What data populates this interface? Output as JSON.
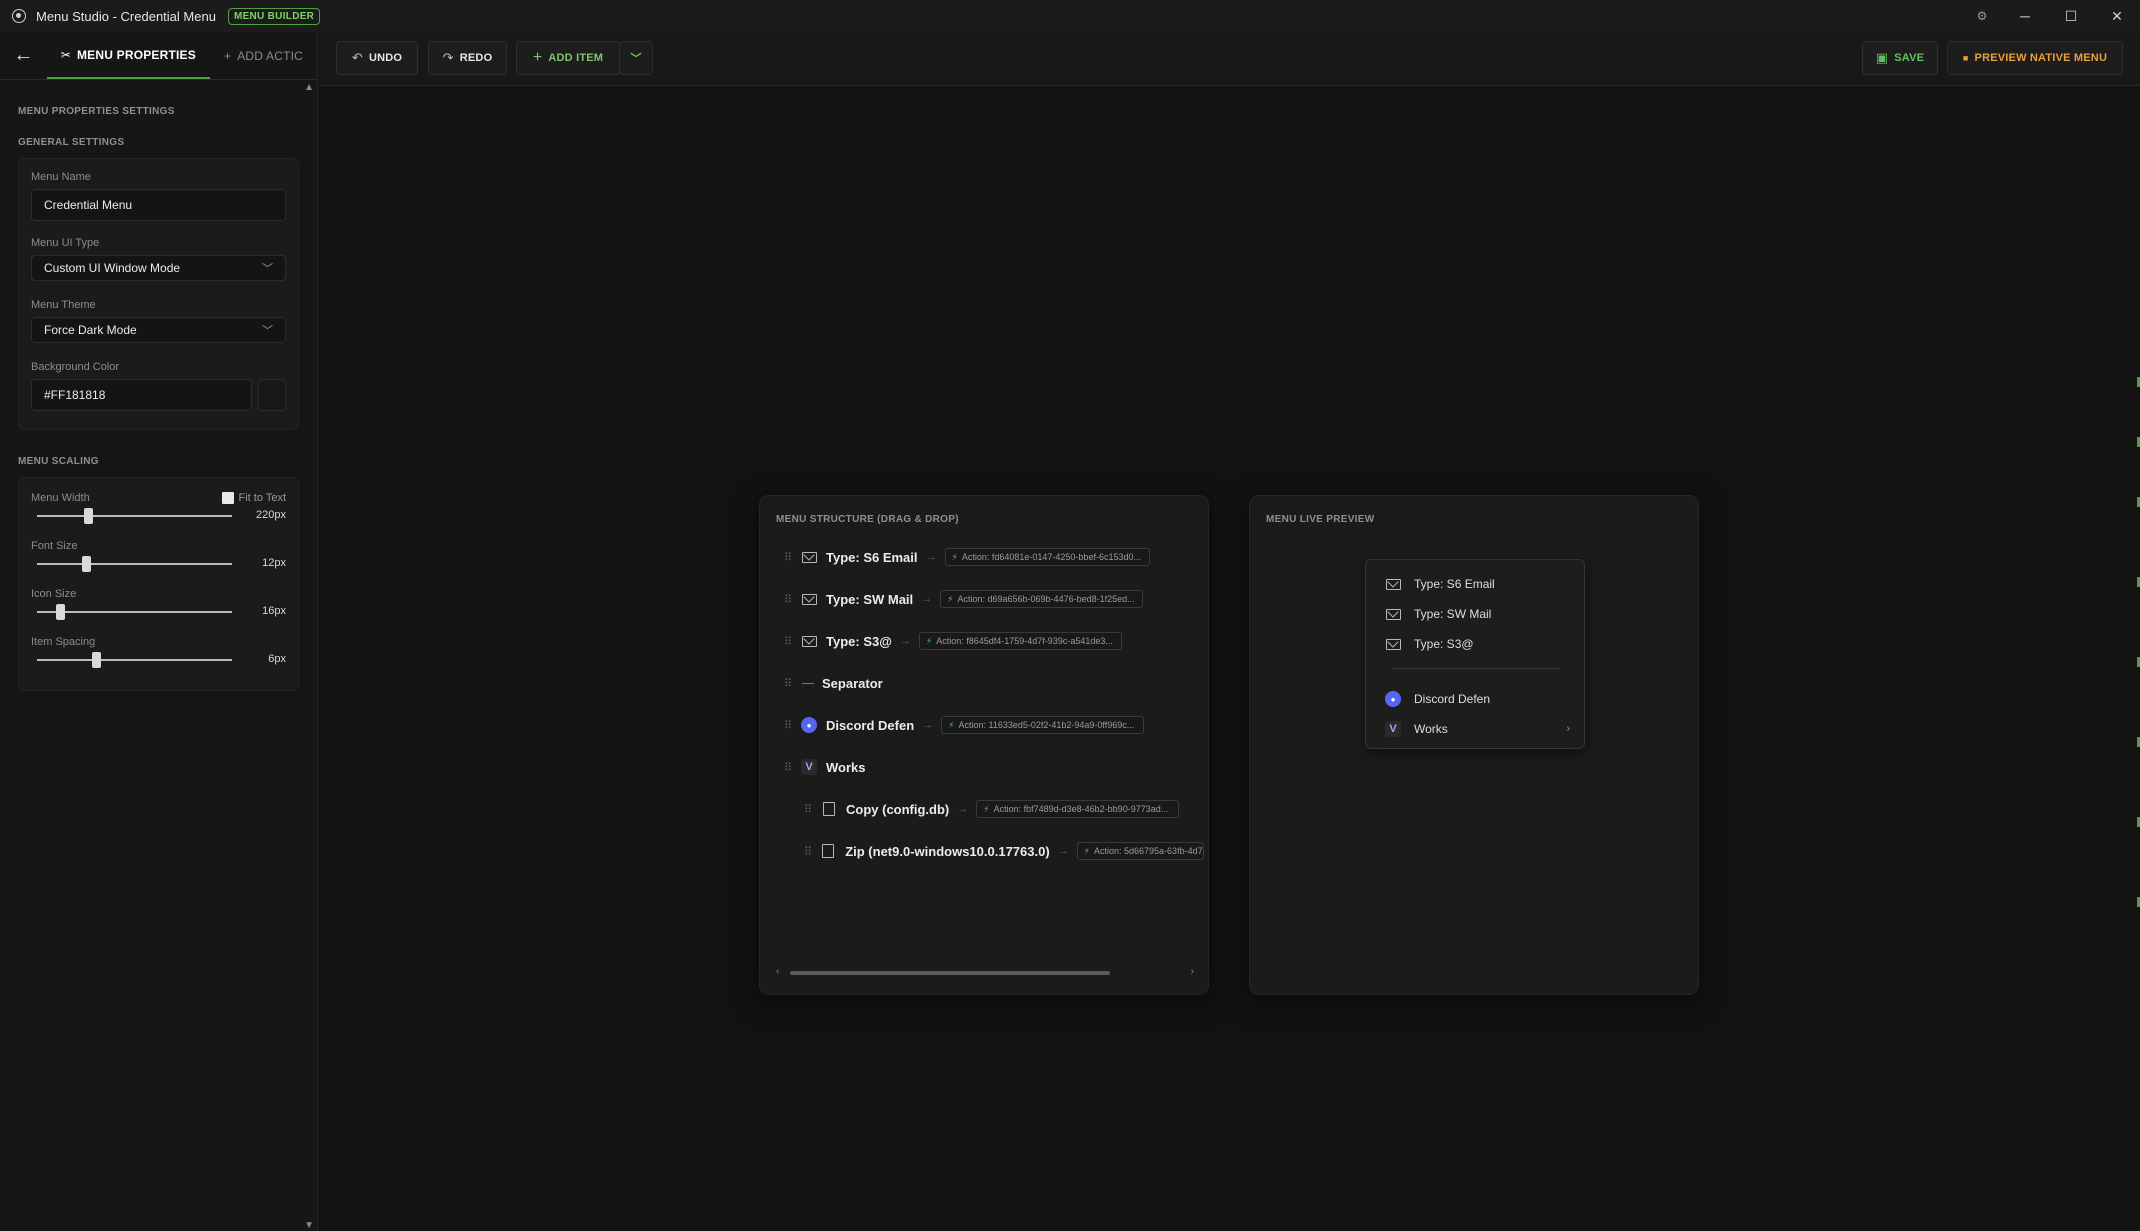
{
  "window": {
    "title": "Menu Studio - Credential Menu",
    "badge": "MENU BUILDER"
  },
  "tabs": {
    "active": "MENU PROPERTIES",
    "inactive": "ADD ACTIC"
  },
  "sidebar": {
    "section_settings": "MENU PROPERTIES SETTINGS",
    "section_general": "GENERAL SETTINGS",
    "menu_name_label": "Menu Name",
    "menu_name_value": "Credential Menu",
    "ui_type_label": "Menu UI Type",
    "ui_type_value": "Custom UI Window Mode",
    "theme_label": "Menu Theme",
    "theme_value": "Force Dark Mode",
    "bg_color_label": "Background Color",
    "bg_color_value": "#FF181818",
    "section_scaling": "MENU SCALING",
    "fit_to_text_label": "Fit to Text",
    "sliders": [
      {
        "label": "Menu Width",
        "value": "220px",
        "fraction": 0.26
      },
      {
        "label": "Font Size",
        "value": "12px",
        "fraction": 0.25
      },
      {
        "label": "Icon Size",
        "value": "16px",
        "fraction": 0.12
      },
      {
        "label": "Item Spacing",
        "value": "6px",
        "fraction": 0.3
      }
    ]
  },
  "toolbar": {
    "undo": "UNDO",
    "redo": "REDO",
    "add_item": "ADD ITEM",
    "save": "SAVE",
    "preview": "PREVIEW NATIVE MENU"
  },
  "structure": {
    "title": "MENU STRUCTURE (DRAG & DROP)",
    "items": [
      {
        "name": "Type: S6 Email",
        "icon": "mail-icon",
        "action": "Action: fd64081e-0147-4250-bbef-6c153d0..."
      },
      {
        "name": "Type: SW Mail",
        "icon": "mail-icon",
        "action": "Action: d69a656b-069b-4476-bed8-1f25ed..."
      },
      {
        "name": "Type: S3@",
        "icon": "mail-icon",
        "action": "Action: f8645df4-1759-4d7f-939c-a541de3..."
      },
      {
        "name": "Separator",
        "icon": "separator-icon",
        "action": ""
      },
      {
        "name": "Discord Defen",
        "icon": "discord-icon",
        "action": "Action: 11633ed5-02f2-41b2-94a9-0ff969c..."
      },
      {
        "name": "Works",
        "icon": "visual-studio-icon",
        "action": ""
      },
      {
        "name": "Copy (config.db)",
        "icon": "file-icon",
        "action": "Action: fbf7489d-d3e8-46b2-bb90-9773ad..."
      },
      {
        "name": "Zip (net9.0-windows10.0.17763.0)",
        "icon": "file-icon",
        "action": "Action: 5d66795a-63fb-4d7"
      }
    ]
  },
  "live_preview": {
    "title": "MENU LIVE PREVIEW",
    "items": [
      "Type: S6 Email",
      "Type: SW Mail",
      "Type: S3@",
      "Discord Defen",
      "Works"
    ]
  },
  "colors": {
    "accent": "#4fa13f",
    "save": "#5fc45f",
    "preview": "#e7a03a",
    "background": "#131313"
  }
}
